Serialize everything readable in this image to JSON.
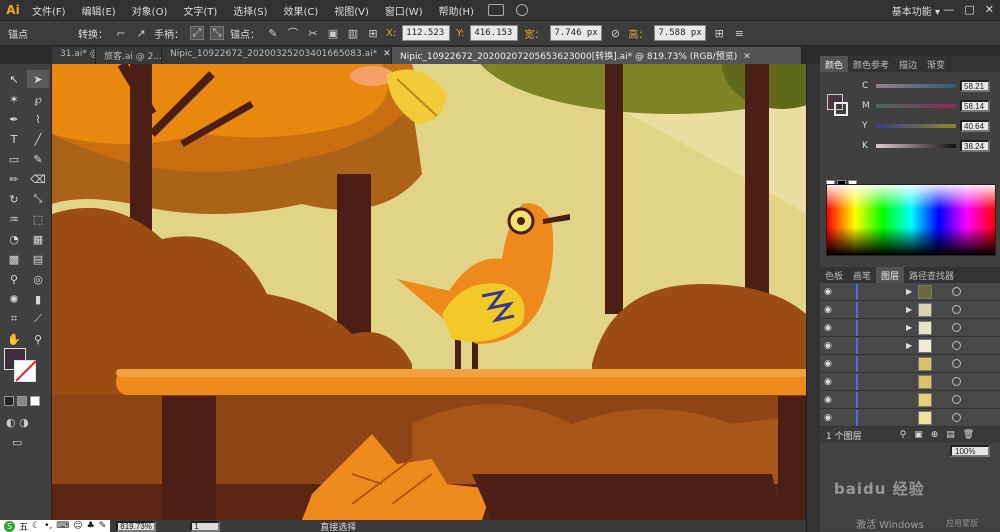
{
  "app": {
    "logo": "Ai",
    "workspace": "基本功能 ▾"
  },
  "menu": [
    {
      "label": "文件(F)"
    },
    {
      "label": "编辑(E)"
    },
    {
      "label": "对象(O)"
    },
    {
      "label": "文字(T)"
    },
    {
      "label": "选择(S)"
    },
    {
      "label": "效果(C)"
    },
    {
      "label": "视图(V)"
    },
    {
      "label": "窗口(W)"
    },
    {
      "label": "帮助(H)"
    }
  ],
  "window_controls": {
    "minimize": "—",
    "maximize": "□",
    "close": "✕"
  },
  "control": {
    "anchor_label": "锚点",
    "convert_label": "转换：",
    "handle_label": "手柄：",
    "anchor2_label": "锚点：",
    "x_key": "X:",
    "x_value": "112.523",
    "y_key": "Y:",
    "y_value": "416.153",
    "w_key": "宽：",
    "w_value": "7.746 px",
    "h_key": "高：",
    "h_value": "7.588 px"
  },
  "tabs": [
    {
      "label": "31.ai* @ ...",
      "close": "✕"
    },
    {
      "label": "旅客.ai @ 2...",
      "close": "✕"
    },
    {
      "label": "Nipic_10922672_20200325203401665083.ai*",
      "close": "✕"
    },
    {
      "label": "Nipic_10922672_20200207205653623000[转换].ai* @ 819.73% (RGB/预览)",
      "close": "✕"
    }
  ],
  "status": {
    "zoom": "819.73%",
    "page": "1",
    "tool": "直接选择"
  },
  "ime": {
    "logo": "S",
    "label": "五"
  },
  "color_panel": {
    "tabs": [
      {
        "label": "颜色"
      },
      {
        "label": "颜色参考"
      },
      {
        "label": "描边"
      },
      {
        "label": "渐变"
      }
    ],
    "channels": [
      {
        "key": "C",
        "value": "58.21"
      },
      {
        "key": "M",
        "value": "58.14"
      },
      {
        "key": "Y",
        "value": "40.64"
      },
      {
        "key": "K",
        "value": "38.24"
      }
    ],
    "fill_color": "#4a3542"
  },
  "layers_panel": {
    "tabs": [
      {
        "label": "色板"
      },
      {
        "label": "画笔"
      },
      {
        "label": "图层"
      },
      {
        "label": "路径查找器"
      }
    ],
    "footer": "1 个图层",
    "rows": 8
  },
  "navigator": {
    "opacity": "100%"
  },
  "watermark": "baidu 经验",
  "activate": {
    "line1": "激活 Windows",
    "line2": "应用蒙版"
  },
  "colors": {
    "sky": "#e2d486",
    "bird_body": "#ee8a1c",
    "bird_wing": "#f3c829",
    "bench_top": "#ee8a1c",
    "trunk": "#4b1e16",
    "bush": "#9c4d15"
  }
}
